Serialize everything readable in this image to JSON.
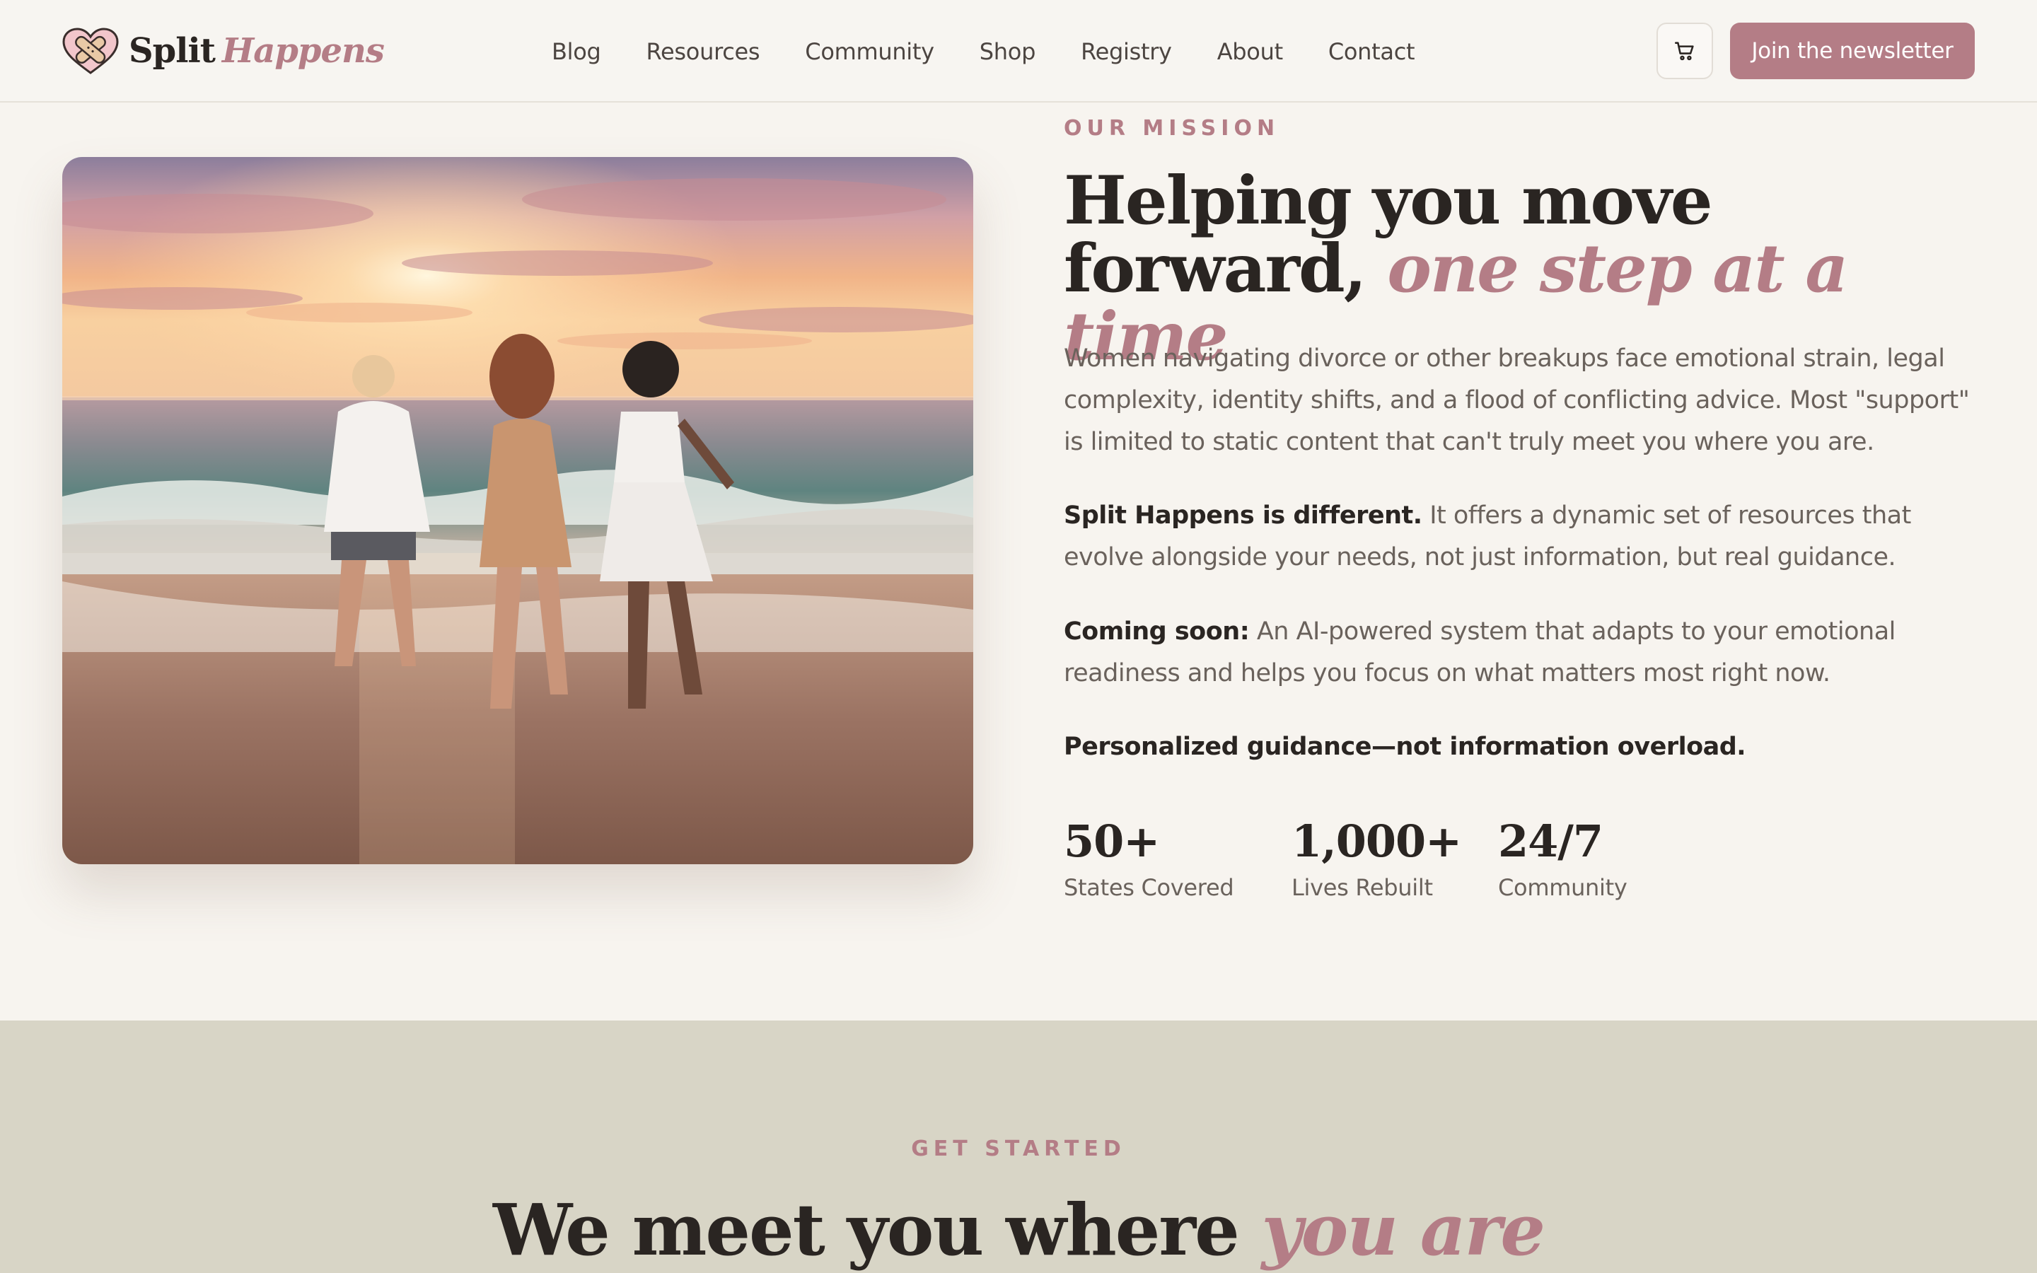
{
  "header": {
    "logo": {
      "brand": "Split",
      "brand_accent": "Happens",
      "icon": "heart-bandage-icon"
    },
    "nav": [
      "Blog",
      "Resources",
      "Community",
      "Shop",
      "Registry",
      "About",
      "Contact"
    ],
    "cart_icon": "cart-icon",
    "cta_label": "Join the newsletter"
  },
  "mission": {
    "eyebrow": "OUR MISSION",
    "headline": "Helping you move forward,",
    "headline_accent": "one step at a time",
    "para1": "Women navigating divorce or other breakups face emotional strain, legal complexity, identity shifts, and a flood of conflicting advice. Most \"support\" is limited to static content that can't truly meet you where you are.",
    "para2_bold": "Split Happens is different.",
    "para2": "It offers a dynamic set of resources that evolve alongside your needs, not just information, but real guidance.",
    "para3_bold": "Coming soon:",
    "para3": "An AI-powered system that adapts to your emotional readiness and helps you focus on what matters most right now.",
    "tagline": "Personalized guidance—not information overload.",
    "stats": [
      {
        "value": "50+",
        "label": "States Covered"
      },
      {
        "value": "1,000+",
        "label": "Lives Rebuilt"
      },
      {
        "value": "24/7",
        "label": "Community"
      }
    ]
  },
  "get_started": {
    "eyebrow": "GET STARTED",
    "title": "We meet you where",
    "title_accent": "you are"
  },
  "colors": {
    "accent": "#b47d86",
    "background": "#f7f4ef",
    "section_bg": "#d8d5c6",
    "text": "#2a2522"
  }
}
